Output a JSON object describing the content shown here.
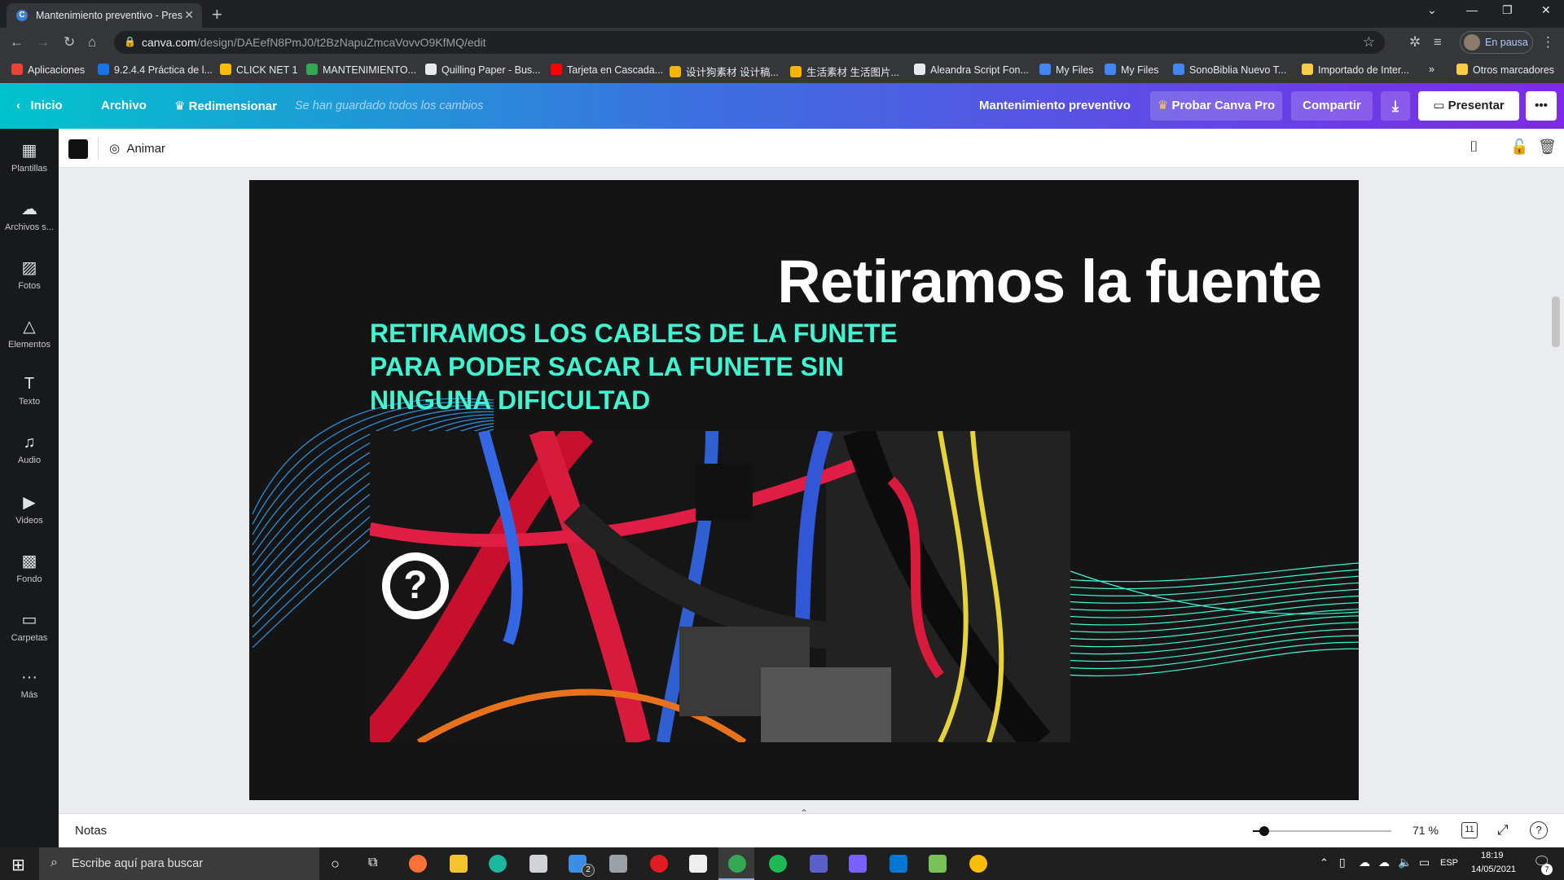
{
  "browser": {
    "tab_title": "Mantenimiento preventivo - Prese",
    "tab_favicon": "C",
    "url_host": "canva.com",
    "url_path": "/design/DAEefN8PmJ0/t2BzNapuZmcaVovvO9KfMQ/edit",
    "profile_label": "En pausa",
    "bookmarks": [
      {
        "label": "Aplicaciones",
        "color": "#ea4335"
      },
      {
        "label": "9.2.4.4 Práctica de l...",
        "color": "#1a73e8"
      },
      {
        "label": "CLICK NET 1",
        "color": "#fbbc04"
      },
      {
        "label": "MANTENIMIENTO...",
        "color": "#34a853"
      },
      {
        "label": "Quilling Paper - Bus...",
        "color": "#e8eaed"
      },
      {
        "label": "Tarjeta en Cascada...",
        "color": "#ff0000"
      },
      {
        "label": "设计狗素材 设计稿...",
        "color": "#f4b400"
      },
      {
        "label": "生活素材 生活图片...",
        "color": "#f4b400"
      },
      {
        "label": "Aleandra Script Fon...",
        "color": "#e8eaed"
      },
      {
        "label": "My Files",
        "color": "#4285f4"
      },
      {
        "label": "My Files",
        "color": "#4285f4"
      },
      {
        "label": "SonoBiblia Nuevo T...",
        "color": "#4285f4"
      },
      {
        "label": "Importado de Inter...",
        "color": "#f9cc48"
      }
    ],
    "other_bookmarks": "Otros marcadores",
    "more_bookmarks": "»"
  },
  "canva": {
    "header": {
      "home": "Inicio",
      "file": "Archivo",
      "resize": "Redimensionar",
      "saved_status": "Se han guardado todos los cambios",
      "design_title": "Mantenimiento preventivo",
      "try_pro": "Probar Canva Pro",
      "share": "Compartir",
      "present": "Presentar"
    },
    "sidebar": [
      {
        "label": "Plantillas",
        "icon": "▦"
      },
      {
        "label": "Archivos s...",
        "icon": "☁"
      },
      {
        "label": "Fotos",
        "icon": "▨"
      },
      {
        "label": "Elementos",
        "icon": "△"
      },
      {
        "label": "Texto",
        "icon": "T"
      },
      {
        "label": "Audio",
        "icon": "♫"
      },
      {
        "label": "Videos",
        "icon": "▶"
      },
      {
        "label": "Fondo",
        "icon": "▩"
      },
      {
        "label": "Carpetas",
        "icon": "▭"
      },
      {
        "label": "Más",
        "icon": "···"
      }
    ],
    "toolbar": {
      "animate": "Animar",
      "color_swatch": "#111111"
    },
    "slide": {
      "title": "Retiramos la fuente",
      "subtitle": "RETIRAMOS LOS CABLES DE LA FUNETE PARA PODER SACAR LA FUNETE SIN NINGUNA DIFICULTAD",
      "accent_color": "#3ff5d2",
      "background_color": "#141414"
    },
    "footer": {
      "notes": "Notas",
      "zoom": "71 %",
      "page_count": "11",
      "zoom_level": 0.08
    }
  },
  "taskbar": {
    "search_placeholder": "Escribe aquí para buscar",
    "language": "ESP",
    "time": "18:19",
    "date": "14/05/2021",
    "mail_badge": "2",
    "notification_badge": "7"
  }
}
